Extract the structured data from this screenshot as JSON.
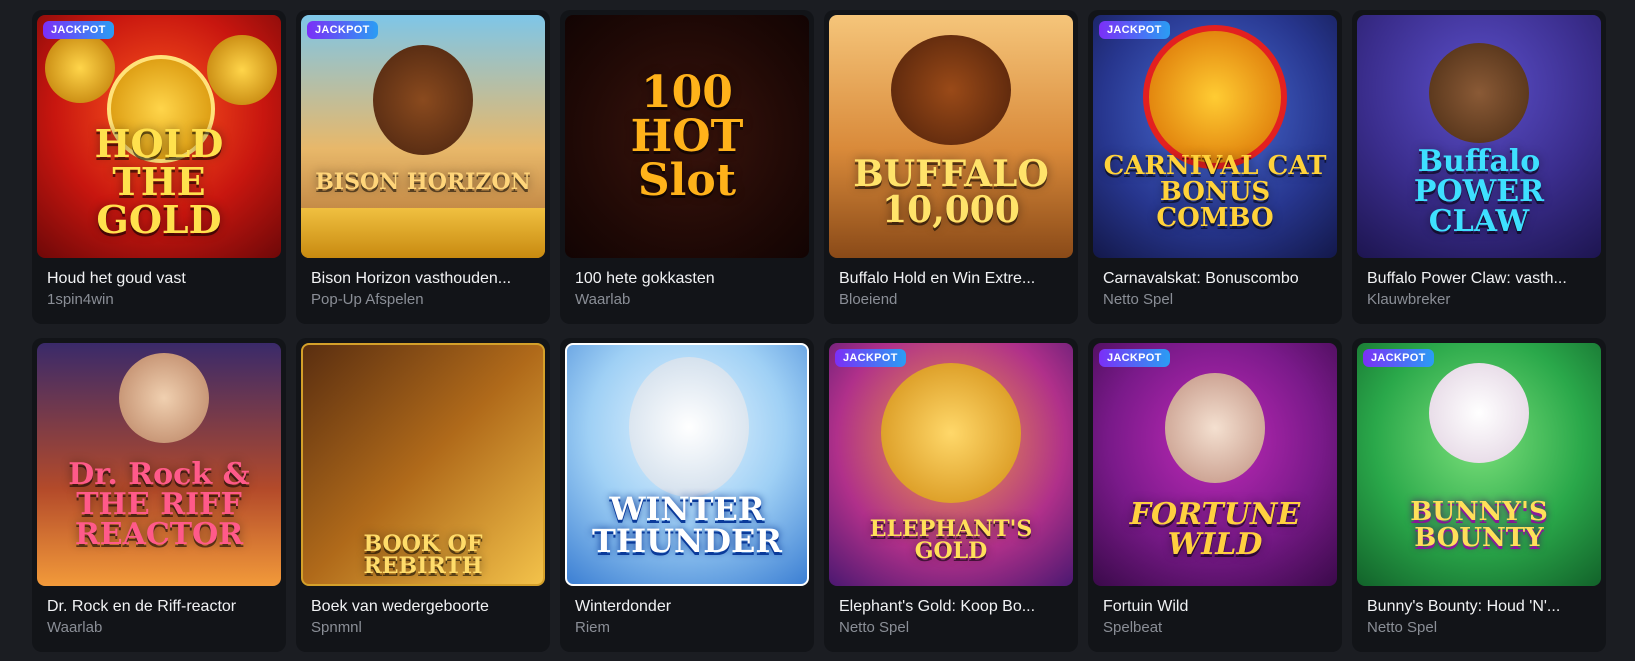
{
  "badge_label": "JACKPOT",
  "games": [
    {
      "title": "Houd het goud vast",
      "provider": "1spin4win",
      "logo": "HOLD THE GOLD",
      "jackpot": true,
      "theme": "hold-gold"
    },
    {
      "title": "Bison Horizon vasthouden...",
      "provider": "Pop-Up Afspelen",
      "logo": "BISON HORIZON",
      "jackpot": true,
      "theme": "bison"
    },
    {
      "title": "100 hete gokkasten",
      "provider": "Waarlab",
      "logo": "100 HOT Slot",
      "jackpot": false,
      "theme": "hot"
    },
    {
      "title": "Buffalo Hold en Win Extre...",
      "provider": "Bloeiend",
      "logo": "BUFFALO 10,000",
      "jackpot": false,
      "theme": "buffalo"
    },
    {
      "title": "Carnavalskat: Bonuscombo",
      "provider": "Netto Spel",
      "logo": "CARNIVAL CAT BONUS COMBO",
      "jackpot": true,
      "theme": "cat"
    },
    {
      "title": "Buffalo Power Claw: vasth...",
      "provider": "Klauwbreker",
      "logo": "Buffalo POWER CLAW",
      "jackpot": false,
      "theme": "claw"
    },
    {
      "title": "Dr. Rock en de Riff-reactor",
      "provider": "Waarlab",
      "logo": "Dr. Rock & THE RIFF REACTOR",
      "jackpot": false,
      "theme": "rock"
    },
    {
      "title": "Boek van wedergeboorte",
      "provider": "Spnmnl",
      "logo": "BOOK OF REBIRTH",
      "jackpot": false,
      "theme": "book"
    },
    {
      "title": "Winterdonder",
      "provider": "Riem",
      "logo": "WINTER THUNDER",
      "jackpot": false,
      "theme": "winter"
    },
    {
      "title": "Elephant's Gold: Koop Bo...",
      "provider": "Netto Spel",
      "logo": "ELEPHANT'S GOLD",
      "jackpot": true,
      "theme": "elephant"
    },
    {
      "title": "Fortuin Wild",
      "provider": "Spelbeat",
      "logo": "FORTUNE WILD",
      "jackpot": true,
      "theme": "fortune"
    },
    {
      "title": "Bunny's Bounty: Houd 'N'...",
      "provider": "Netto Spel",
      "logo": "BUNNY'S BOUNTY",
      "jackpot": true,
      "theme": "bunny"
    }
  ]
}
